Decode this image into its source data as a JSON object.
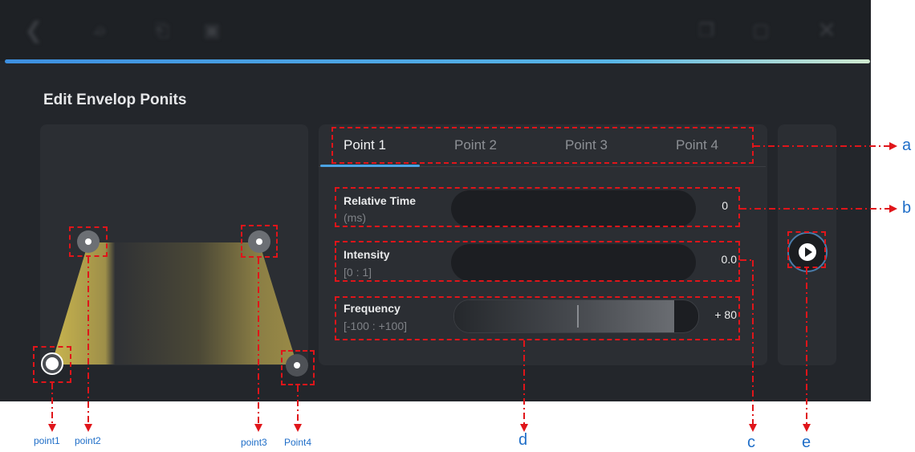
{
  "title": "Edit Envelop Ponits",
  "toolbar_icons": [
    "back-icon",
    "export-icon",
    "import-icon",
    "crop-icon",
    "copy-icon",
    "delete-icon",
    "close-icon"
  ],
  "tabs": [
    "Point 1",
    "Point 2",
    "Point 3",
    "Point 4"
  ],
  "active_tab": "Point 1",
  "fields": {
    "relative_time": {
      "label": "Relative Time",
      "sub": "(ms)",
      "value": "0"
    },
    "intensity": {
      "label": "Intensity",
      "sub": "[0 : 1]",
      "value": "0.0"
    },
    "frequency": {
      "label": "Frequency",
      "sub": "[-100 : +100]",
      "value": "+ 80",
      "level": 80,
      "range": [
        -100,
        100
      ]
    }
  },
  "annotations": {
    "letters": [
      "a",
      "b",
      "c",
      "d",
      "e"
    ],
    "points": [
      "point1",
      "point2",
      "point3",
      "Point4"
    ]
  },
  "colors": {
    "accent": "#4ba3e3",
    "annotation_red": "#e0151a",
    "annotation_blue": "#1f6ec8",
    "envelope_fill": "#b8a64a"
  }
}
